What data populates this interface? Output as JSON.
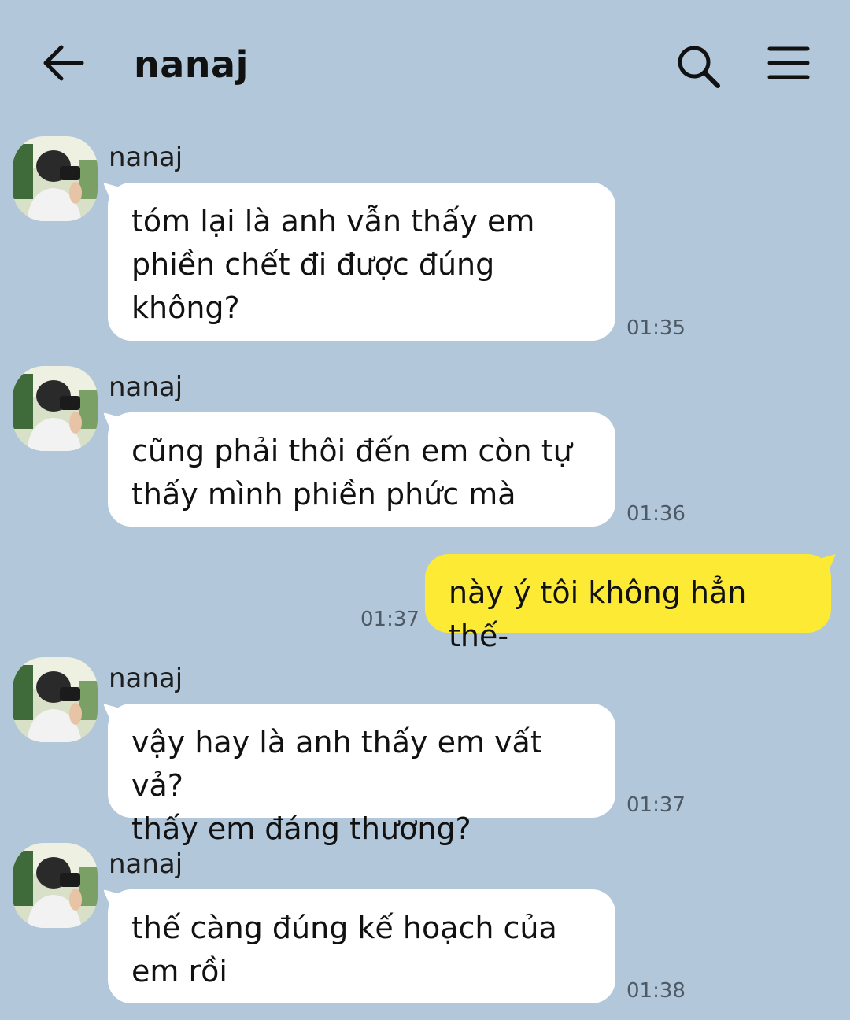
{
  "header": {
    "title": "nanaj",
    "back_icon": "arrow-left-icon",
    "search_icon": "search-icon",
    "menu_icon": "hamburger-menu-icon"
  },
  "colors": {
    "background": "#b2c7da",
    "incoming_bubble": "#ffffff",
    "outgoing_bubble": "#fcea34",
    "timestamp": "#4d5a66"
  },
  "messages": [
    {
      "direction": "incoming",
      "sender": "nanaj",
      "text": "tóm lại là anh vẫn thấy em\nphiền chết đi được đúng\nkhông?",
      "time": "01:35"
    },
    {
      "direction": "incoming",
      "sender": "nanaj",
      "text": "cũng phải thôi đến em còn tự\nthấy mình phiền phức mà",
      "time": "01:36"
    },
    {
      "direction": "outgoing",
      "text": "này ý tôi không hẳn thế-",
      "time": "01:37"
    },
    {
      "direction": "incoming",
      "sender": "nanaj",
      "text": "vậy hay là anh thấy em vất vả?\nthấy em đáng thương?",
      "time": "01:37"
    },
    {
      "direction": "incoming",
      "sender": "nanaj",
      "text": "thế càng đúng kế hoạch của\nem rồi",
      "time": "01:38"
    }
  ]
}
